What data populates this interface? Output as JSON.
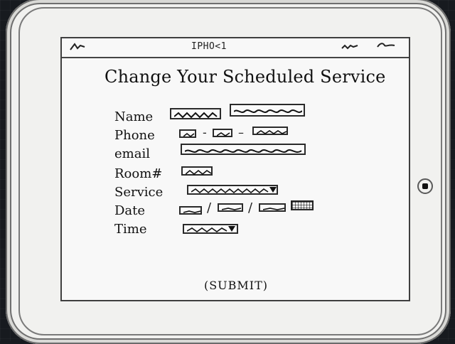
{
  "status_bar": {
    "carrier_icon": "signal-scribble-icon",
    "center_text": "IPHO<1",
    "right_icons": [
      "wifi-scribble-icon",
      "battery-scribble-icon"
    ]
  },
  "page": {
    "title": "Change Your Scheduled Service"
  },
  "form": {
    "name_label": "Name",
    "phone_label": "Phone",
    "email_label": "email",
    "room_label": "Room#",
    "service_label": "Service",
    "date_label": "Date",
    "time_label": "Time",
    "phone_sep_1": "-",
    "phone_sep_2": "–",
    "date_sep_1": "/",
    "date_sep_2": "/",
    "calendar_icon": "calendar-icon",
    "dropdown_icon": "triangle-down-icon"
  },
  "submit_label": "(SUBMIT)",
  "device": {
    "home_button_icon": "home-button-icon"
  }
}
